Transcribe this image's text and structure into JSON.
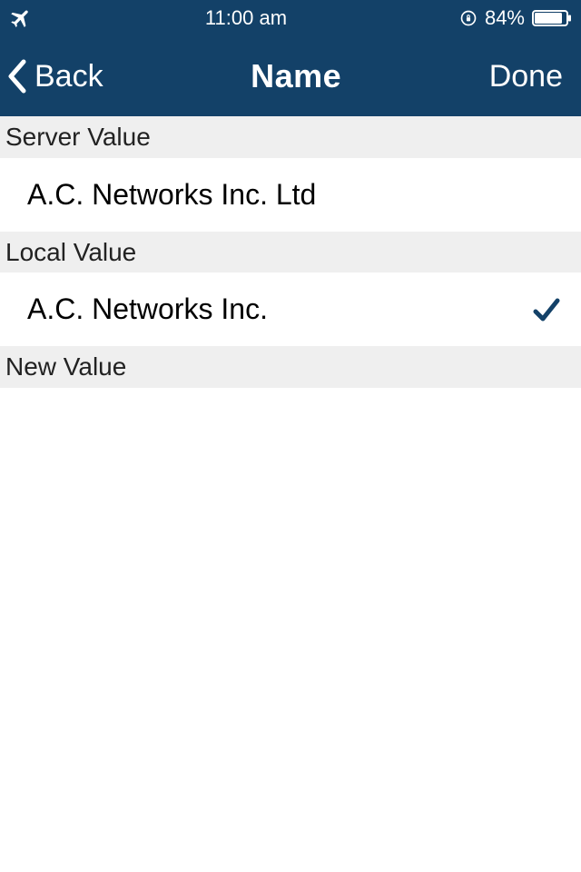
{
  "colors": {
    "nav": "#134168",
    "accent": "#1c4c7a"
  },
  "status_bar": {
    "airplane_mode": true,
    "time": "11:00 am",
    "orientation_lock": true,
    "battery_percent": "84%"
  },
  "nav": {
    "back_label": "Back",
    "title": "Name",
    "done_label": "Done"
  },
  "sections": {
    "server": {
      "header": "Server Value",
      "value": "A.C. Networks Inc. Ltd",
      "selected": false
    },
    "local": {
      "header": "Local Value",
      "value": "A.C. Networks Inc.",
      "selected": true
    },
    "new": {
      "header": "New Value",
      "value": ""
    }
  }
}
